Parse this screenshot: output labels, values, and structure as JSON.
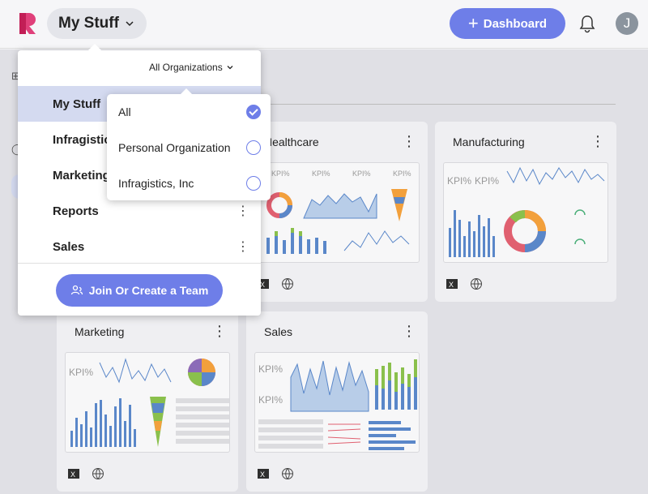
{
  "header": {
    "workspace_label": "My Stuff",
    "dashboard_button": "Dashboard",
    "avatar_initial": "J",
    "accent_color": "#6e7ee8"
  },
  "workspace_menu": {
    "org_selector": "All Organizations",
    "items": [
      {
        "label": "My Stuff"
      },
      {
        "label": "Infragistics"
      },
      {
        "label": "Marketing"
      },
      {
        "label": "Reports"
      },
      {
        "label": "Sales"
      }
    ],
    "join_button": "Join Or Create a Team"
  },
  "org_popup": {
    "options": [
      {
        "label": "All",
        "selected": true
      },
      {
        "label": "Personal Organization",
        "selected": false
      },
      {
        "label": "Infragistics, Inc",
        "selected": false
      }
    ]
  },
  "dashboards": [
    {
      "title": "Healthcare",
      "thumb_kpi": "KPI"
    },
    {
      "title": "Manufacturing",
      "thumb_kpi": "KPI"
    },
    {
      "title": "Marketing",
      "thumb_kpi": "KPI"
    },
    {
      "title": "Sales",
      "thumb_kpi": "KPI"
    }
  ]
}
